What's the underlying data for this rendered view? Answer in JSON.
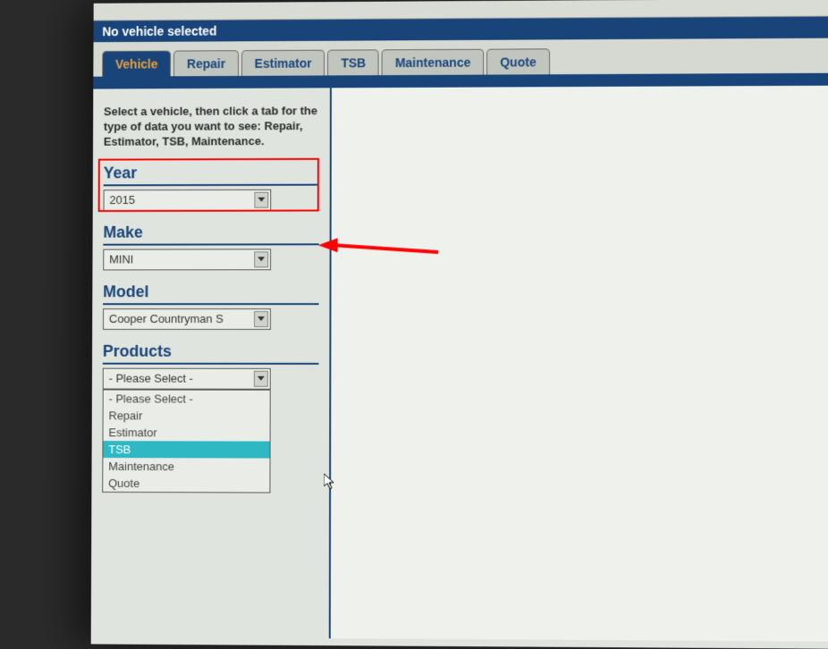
{
  "status_bar": {
    "text": "No vehicle selected"
  },
  "tabs": {
    "items": [
      {
        "label": "Vehicle",
        "active": true
      },
      {
        "label": "Repair",
        "active": false
      },
      {
        "label": "Estimator",
        "active": false
      },
      {
        "label": "TSB",
        "active": false
      },
      {
        "label": "Maintenance",
        "active": false
      },
      {
        "label": "Quote",
        "active": false
      }
    ]
  },
  "panel": {
    "intro": "Select a vehicle, then click a tab for the type of data you want to see: Repair, Estimator, TSB, Maintenance.",
    "year": {
      "label": "Year",
      "value": "2015"
    },
    "make": {
      "label": "Make",
      "value": "MINI"
    },
    "model": {
      "label": "Model",
      "value": "Cooper Countryman S"
    },
    "products": {
      "label": "Products",
      "value": "- Please Select -",
      "options": [
        "- Please Select -",
        "Repair",
        "Estimator",
        "TSB",
        "Maintenance",
        "Quote"
      ],
      "hover_index": 3
    }
  },
  "annotation": {
    "arrow_color": "#ff0000"
  }
}
